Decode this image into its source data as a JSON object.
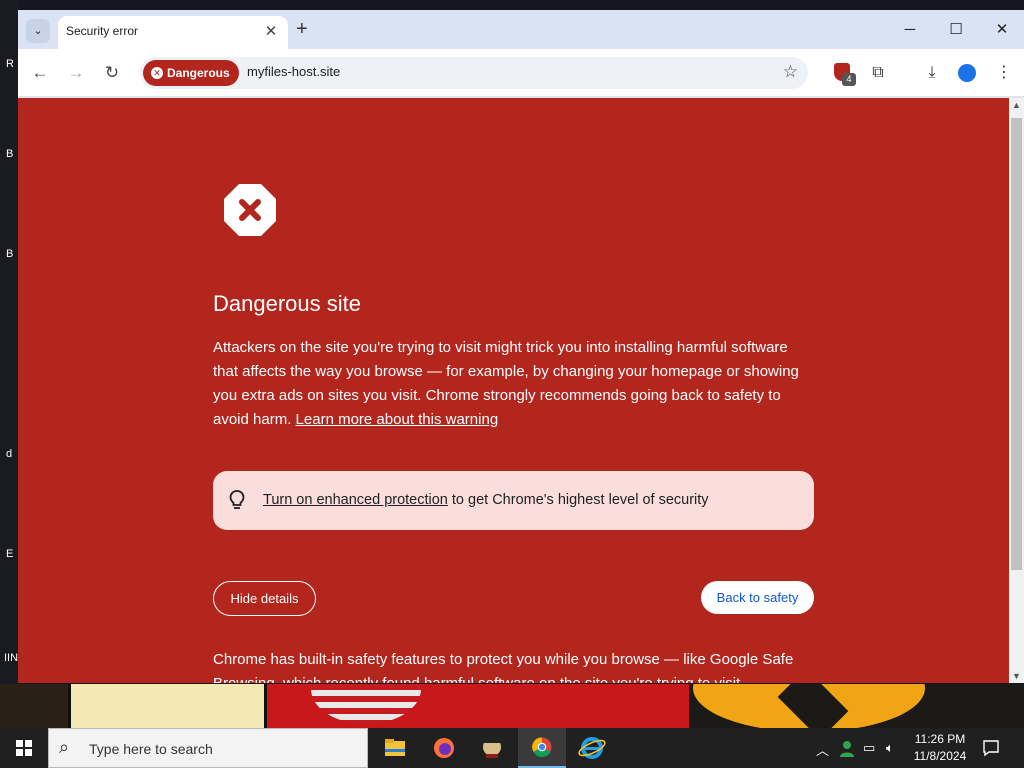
{
  "desktop": {
    "edge_letters": [
      "R",
      "B",
      "B",
      "d",
      "E",
      "IIN"
    ]
  },
  "tab": {
    "title": "Security error",
    "close_glyph": "✕"
  },
  "tabstrip": {
    "search_tabs_glyph": "⌄",
    "new_tab_glyph": "+"
  },
  "window_controls": {
    "minimize": "─",
    "maximize": "☐",
    "close": "✕"
  },
  "toolbar": {
    "back_glyph": "←",
    "forward_glyph": "→",
    "reload_glyph": "↻",
    "security_chip": "Dangerous",
    "url": "myfiles-host.site",
    "bookmark_glyph": "☆",
    "extension_badge": "4",
    "extensions_glyph": "⧉",
    "downloads_glyph": "⤓",
    "menu_glyph": "⋮"
  },
  "interstitial": {
    "heading": "Dangerous site",
    "body_lead": "Attackers on the site you're trying to visit might trick you into installing harmful software that affects the way you browse — for example, by changing your homepage or showing you extra ads on sites you visit. Chrome strongly recommends going back to safety to avoid harm. ",
    "learn_more_link": "Learn more about this warning",
    "protection_link": "Turn on enhanced protection",
    "protection_rest": " to get Chrome's highest level of security",
    "hide_details_button": "Hide details",
    "back_to_safety_button": "Back to safety",
    "details_lead": "Chrome has built-in safety features to protect you while you browse — like Google Safe Browsing, which recently ",
    "details_link": "found harmful software",
    "details_rest": " on the site you're trying to visit."
  },
  "taskbar": {
    "search_placeholder": "Type here to search",
    "apps": [
      "file-explorer",
      "firefox",
      "pirate-app",
      "chrome",
      "internet-explorer"
    ],
    "time": "11:26 PM",
    "date": "11/8/2024"
  },
  "colors": {
    "danger_red": "#b3261e",
    "protect_bg": "#f9dedc",
    "link_blue": "#0b57d0",
    "taskbar": "#202020"
  }
}
